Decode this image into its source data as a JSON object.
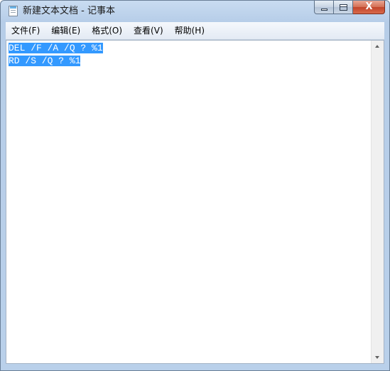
{
  "window": {
    "title": "新建文本文档 - 记事本",
    "icon": "notepad-icon"
  },
  "caption": {
    "close_glyph": "X"
  },
  "menu": {
    "items": [
      {
        "label": "文件(F)"
      },
      {
        "label": "编辑(E)"
      },
      {
        "label": "格式(O)"
      },
      {
        "label": "查看(V)"
      },
      {
        "label": "帮助(H)"
      }
    ]
  },
  "document": {
    "lines": [
      "DEL /F /A /Q ? %1",
      "RD /S /Q ? %1"
    ],
    "selection_color": "#3399ff"
  }
}
